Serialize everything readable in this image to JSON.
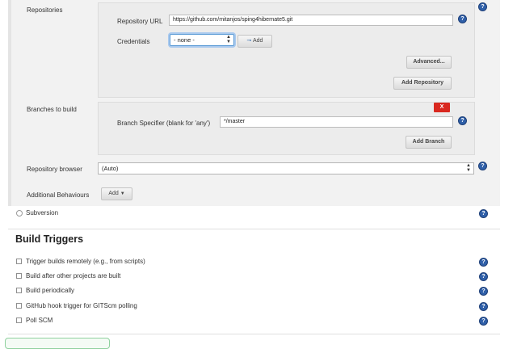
{
  "scm": {
    "repositories_label": "Repositories",
    "repo_url_label": "Repository URL",
    "repo_url_value": "https://github.com/mitanjos/sping4hibernate5.git",
    "credentials_label": "Credentials",
    "credentials_value": "- none -",
    "add_credentials_label": "Add",
    "advanced_button": "Advanced...",
    "add_repository_button": "Add Repository",
    "branches_label": "Branches to build",
    "delete_branch_label": "X",
    "branch_specifier_label": "Branch Specifier (blank for 'any')",
    "branch_specifier_value": "*/master",
    "add_branch_button": "Add Branch",
    "repo_browser_label": "Repository browser",
    "repo_browser_value": "(Auto)",
    "additional_behaviours_label": "Additional Behaviours",
    "add_behaviour_button": "Add",
    "subversion_label": "Subversion"
  },
  "build_triggers": {
    "heading": "Build Triggers",
    "options": [
      "Trigger builds remotely (e.g., from scripts)",
      "Build after other projects are built",
      "Build periodically",
      "GitHub hook trigger for GITScm polling",
      "Poll SCM"
    ]
  },
  "help_glyph": "?",
  "colors": {
    "help": "#2f5fa8",
    "delete": "#d9281f",
    "focus": "#5b9bd5"
  }
}
